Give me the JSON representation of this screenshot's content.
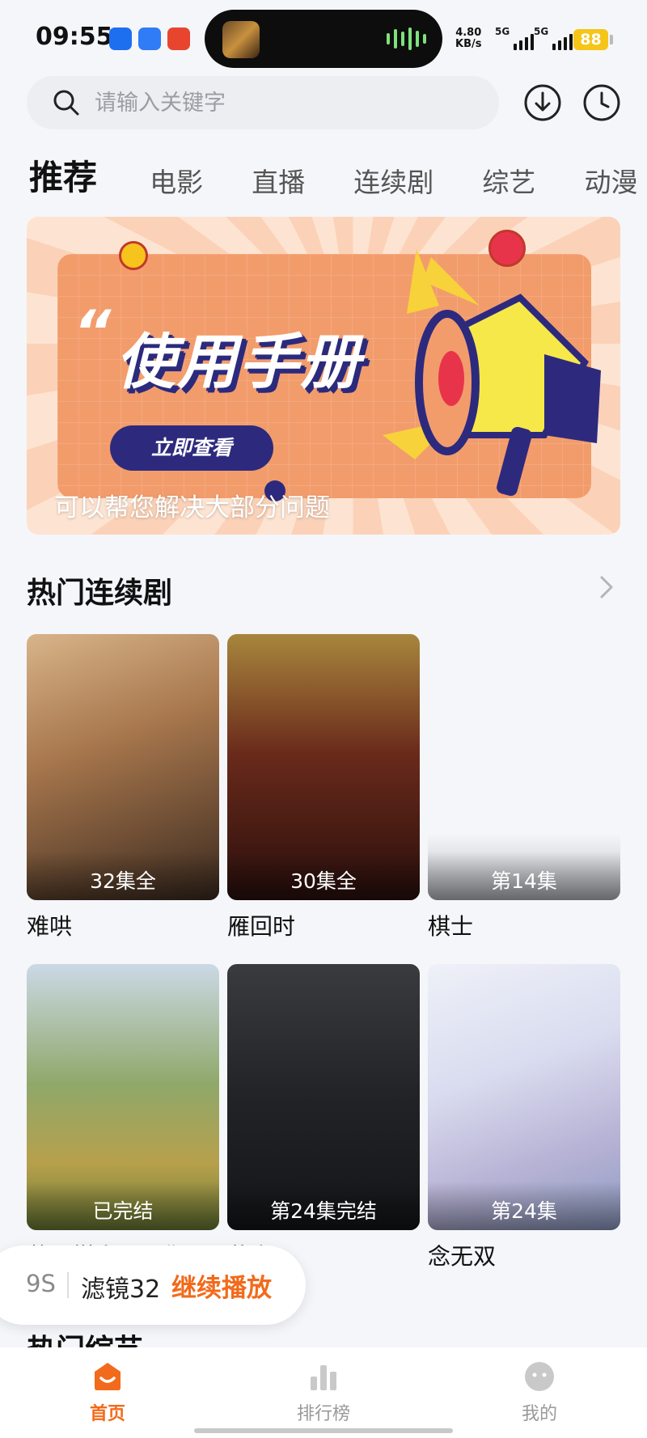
{
  "status_bar": {
    "time": "09:55",
    "net_speed": "4.80",
    "net_unit": "KB/s",
    "sim1": "5G",
    "sim2": "5G",
    "battery": "88"
  },
  "search": {
    "placeholder": "请输入关键字"
  },
  "tabs": [
    "推荐",
    "电影",
    "直播",
    "连续剧",
    "综艺",
    "动漫"
  ],
  "banner": {
    "title": "使用手册",
    "button": "立即查看",
    "subtitle": "可以帮您解决大部分问题"
  },
  "hot_series": {
    "title": "热门连续剧",
    "items": [
      {
        "name": "难哄",
        "badge": "32集全"
      },
      {
        "name": "雁回时",
        "badge": "30集全"
      },
      {
        "name": "棋士",
        "badge": "第14集"
      },
      {
        "name": "苦尽柑来遇见你",
        "badge": "已完结"
      },
      {
        "name": "黄雀",
        "badge": "第24集完结"
      },
      {
        "name": "念无双",
        "badge": "第24集"
      }
    ]
  },
  "hot_variety": {
    "title": "热门综艺"
  },
  "continue": {
    "episode": "9S",
    "name": "滤镜32",
    "action": "继续播放"
  },
  "tabbar": [
    {
      "label": "首页",
      "icon": "home-icon"
    },
    {
      "label": "排行榜",
      "icon": "ranking-icon"
    },
    {
      "label": "我的",
      "icon": "profile-icon"
    }
  ],
  "colors": {
    "accent": "#f26a1b",
    "banner_bg": "#f29c6c",
    "banner_navy": "#2d2a7e"
  }
}
